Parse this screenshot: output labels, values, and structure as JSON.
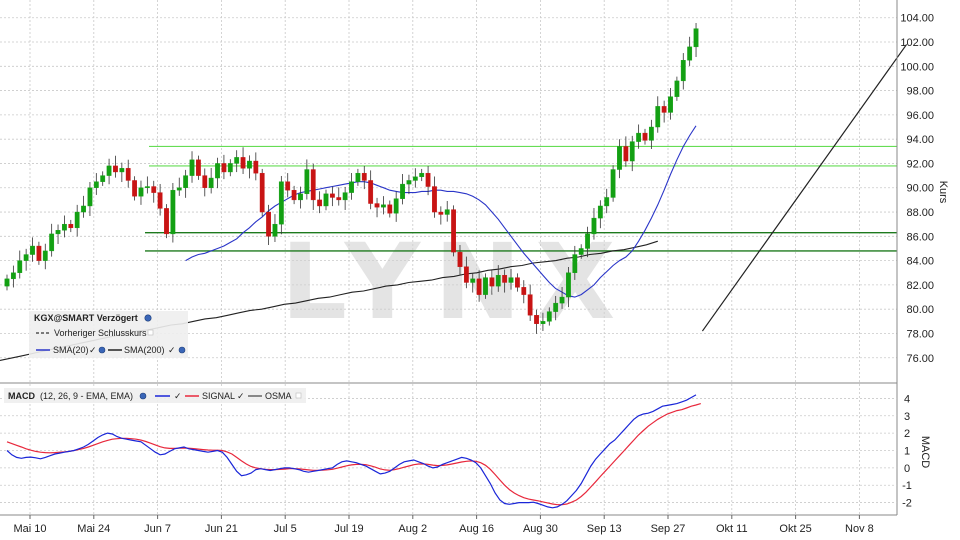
{
  "watermark": "LYNX",
  "colors": {
    "up": "#13a013",
    "down": "#c81414",
    "sma20": "#2a35c8",
    "sma200": "#222222",
    "macd": "#1a26d8",
    "signal": "#e8283c",
    "grid": "#c9c9c9",
    "support_dark": "#1e7a1e",
    "support_light": "#66dd55",
    "trendline": "#222222"
  },
  "legend": {
    "instrument": "KGX@SMART Verzögert",
    "prev_close": "Vorheriger Schlusskurs",
    "sma20": "SMA(20)",
    "sma200": "SMA(200)"
  },
  "macd_legend": {
    "label": "MACD",
    "params": "(12, 26, 9 - EMA, EMA)",
    "signal": "SIGNAL",
    "osma": "OSMA"
  },
  "chart_data": [
    {
      "type": "candlestick",
      "ylabel": "Kurs",
      "ylim": [
        74.5,
        104.8
      ],
      "yticks": [
        76,
        78,
        80,
        82,
        84,
        86,
        88,
        90,
        92,
        94,
        96,
        98,
        100,
        102,
        104
      ],
      "ytick_labels": [
        "76.00",
        "78.00",
        "80.00",
        "82.00",
        "84.00",
        "86.00",
        "88.00",
        "90.00",
        "92.00",
        "94.00",
        "96.00",
        "98.00",
        "100.00",
        "102.00",
        "104.00"
      ],
      "x_tick_labels": [
        "Mai 10",
        "Mai 24",
        "Jun 7",
        "Jun 21",
        "Jul 5",
        "Jul 19",
        "Aug 2",
        "Aug 16",
        "Aug 30",
        "Sep 13",
        "Sep 27",
        "Okt 11",
        "Okt 25",
        "Nov 8"
      ],
      "x_tick_index": [
        0,
        10,
        20,
        30,
        40,
        50,
        60,
        70,
        80,
        90,
        100,
        110,
        120,
        130
      ],
      "grid": true,
      "horizontal_lines": [
        {
          "y": 93.4,
          "style": "light"
        },
        {
          "y": 91.8,
          "style": "light"
        },
        {
          "y": 86.3,
          "style": "dark"
        },
        {
          "y": 84.8,
          "style": "dark"
        }
      ],
      "trendline": {
        "from": [
          109,
          78.2
        ],
        "to": [
          141,
          101.8
        ]
      },
      "close": [
        82.5,
        83.0,
        84.0,
        84.5,
        85.2,
        84.0,
        84.8,
        86.2,
        86.5,
        87.0,
        86.7,
        88.0,
        88.5,
        90.0,
        90.5,
        91.0,
        91.8,
        91.3,
        91.6,
        90.6,
        89.3,
        90.0,
        90.1,
        89.6,
        88.3,
        86.2,
        89.8,
        90.0,
        91.0,
        92.3,
        91.0,
        90.0,
        90.8,
        92.0,
        91.3,
        92.0,
        92.5,
        91.6,
        92.2,
        91.2,
        88.0,
        86.0,
        87.0,
        90.5,
        89.8,
        89.0,
        89.5,
        91.5,
        89.0,
        88.5,
        89.5,
        89.2,
        89.0,
        89.6,
        90.5,
        91.2,
        90.6,
        88.7,
        88.4,
        88.6,
        87.9,
        89.1,
        90.3,
        90.6,
        90.9,
        91.2,
        90.1,
        88.0,
        87.8,
        88.2,
        84.7,
        83.5,
        82.2,
        82.5,
        81.2,
        82.6,
        81.9,
        82.8,
        82.2,
        82.6,
        81.8,
        81.2,
        79.5,
        78.8,
        79.0,
        79.8,
        80.5,
        81.0,
        83.0,
        84.5,
        85.0,
        86.2,
        87.5,
        88.5,
        89.2,
        91.5,
        93.4,
        92.2,
        93.8,
        94.5,
        93.9,
        95.0,
        96.7,
        96.2,
        97.5,
        98.8,
        100.5,
        101.6,
        103.1
      ],
      "series": [
        {
          "name": "SMA(20)",
          "values": [
            84.0,
            84.3,
            84.5,
            84.6,
            84.8,
            85.0,
            85.2,
            85.5,
            85.8,
            86.3,
            86.7,
            87.2,
            87.6,
            88.1,
            88.5,
            88.8,
            89.1,
            89.4,
            89.6,
            89.7,
            89.8,
            89.9,
            90.0,
            90.1,
            90.2,
            90.3,
            90.4,
            90.5,
            90.5,
            90.4,
            90.2,
            90.0,
            89.8,
            89.7,
            89.6,
            89.6,
            89.6,
            89.7,
            89.7,
            89.8,
            89.8,
            89.7,
            89.7,
            89.6,
            89.5,
            89.3,
            89.0,
            88.6,
            88.0,
            87.4,
            86.7,
            86.0,
            85.3,
            84.6,
            84.0,
            83.4,
            82.8,
            82.2,
            81.7,
            81.4,
            81.1,
            81.0,
            81.2,
            81.6,
            82.0,
            82.6,
            83.1,
            83.6,
            84.0,
            84.3,
            84.8,
            85.6,
            86.5,
            87.5,
            88.6,
            89.8,
            91.1,
            92.3,
            93.4,
            94.3,
            95.1
          ]
        },
        {
          "name": "SMA(200)",
          "values": [
            75.0,
            75.2,
            75.4,
            75.6,
            75.8,
            76.0,
            76.2,
            76.4,
            76.6,
            76.8,
            77.0,
            77.2,
            77.4,
            77.6,
            77.8,
            78.0,
            78.2,
            78.3,
            78.5,
            78.7,
            78.8,
            79.0,
            79.2,
            79.3,
            79.5,
            79.7,
            79.9,
            80.0,
            80.2,
            80.4,
            80.5,
            80.7,
            80.9,
            81.0,
            81.2,
            81.4,
            81.5,
            81.7,
            81.9,
            82.0,
            82.2,
            82.3,
            82.4,
            82.6,
            82.7,
            82.9,
            83.0,
            83.2,
            83.3,
            83.5,
            83.6,
            83.8,
            83.9,
            84.0,
            84.2,
            84.3,
            84.5,
            84.6,
            84.8,
            84.9,
            85.1,
            85.3,
            85.6
          ]
        }
      ]
    },
    {
      "type": "line",
      "ylabel": "MACD",
      "ylim": [
        -2.6,
        4.6
      ],
      "yticks": [
        -2,
        -1,
        0,
        1,
        2,
        3,
        4
      ],
      "grid": true,
      "series": [
        {
          "name": "MACD",
          "values": [
            1.0,
            0.75,
            0.6,
            0.55,
            0.6,
            0.62,
            0.58,
            0.52,
            0.6,
            0.7,
            0.8,
            0.85,
            0.9,
            0.95,
            1.0,
            1.1,
            1.2,
            1.35,
            1.55,
            1.75,
            1.9,
            2.0,
            1.95,
            1.8,
            1.7,
            1.65,
            1.6,
            1.55,
            1.5,
            1.3,
            1.1,
            0.9,
            0.75,
            0.8,
            0.95,
            1.1,
            1.15,
            1.2,
            1.1,
            1.05,
            1.0,
            0.95,
            0.9,
            0.95,
            1.0,
            0.9,
            0.6,
            0.2,
            -0.2,
            -0.45,
            -0.4,
            -0.3,
            -0.1,
            -0.05,
            -0.1,
            -0.15,
            -0.1,
            -0.05,
            0.0,
            0.0,
            -0.05,
            -0.1,
            -0.2,
            -0.25,
            -0.2,
            -0.15,
            -0.1,
            -0.05,
            0.0,
            0.2,
            0.35,
            0.4,
            0.35,
            0.3,
            0.2,
            0.1,
            -0.05,
            -0.2,
            -0.35,
            -0.3,
            -0.2,
            0.0,
            0.2,
            0.35,
            0.4,
            0.45,
            0.35,
            0.25,
            0.1,
            0.0,
            0.05,
            0.2,
            0.3,
            0.4,
            0.5,
            0.6,
            0.55,
            0.45,
            0.3,
            0.0,
            -0.45,
            -0.9,
            -1.45,
            -1.85,
            -2.05,
            -2.1,
            -2.05,
            -2.0,
            -2.0,
            -2.0,
            -1.98,
            -2.05,
            -2.15,
            -2.25,
            -2.3,
            -2.25,
            -2.1,
            -1.9,
            -1.6,
            -1.3,
            -0.9,
            -0.4,
            0.1,
            0.5,
            0.8,
            1.1,
            1.4,
            1.6,
            1.9,
            2.2,
            2.5,
            2.8,
            3.0,
            3.1,
            3.15,
            3.25,
            3.4,
            3.55,
            3.6,
            3.65,
            3.7,
            3.8,
            3.9,
            4.05,
            4.2
          ]
        },
        {
          "name": "SIGNAL",
          "values": [
            1.5,
            1.4,
            1.3,
            1.2,
            1.1,
            1.02,
            0.95,
            0.9,
            0.88,
            0.87,
            0.88,
            0.9,
            0.92,
            0.95,
            1.0,
            1.05,
            1.12,
            1.2,
            1.3,
            1.4,
            1.5,
            1.58,
            1.65,
            1.68,
            1.7,
            1.7,
            1.68,
            1.65,
            1.6,
            1.52,
            1.42,
            1.32,
            1.22,
            1.15,
            1.12,
            1.12,
            1.13,
            1.14,
            1.13,
            1.11,
            1.08,
            1.05,
            1.03,
            1.02,
            1.02,
            1.0,
            0.92,
            0.8,
            0.6,
            0.4,
            0.22,
            0.08,
            0.0,
            -0.05,
            -0.08,
            -0.1,
            -0.1,
            -0.09,
            -0.07,
            -0.05,
            -0.05,
            -0.06,
            -0.09,
            -0.12,
            -0.14,
            -0.14,
            -0.13,
            -0.11,
            -0.08,
            -0.02,
            0.05,
            0.12,
            0.17,
            0.2,
            0.2,
            0.18,
            0.12,
            0.04,
            -0.06,
            -0.12,
            -0.14,
            -0.1,
            -0.04,
            0.04,
            0.11,
            0.18,
            0.22,
            0.23,
            0.2,
            0.16,
            0.13,
            0.14,
            0.17,
            0.22,
            0.28,
            0.34,
            0.38,
            0.4,
            0.38,
            0.3,
            0.15,
            -0.08,
            -0.38,
            -0.7,
            -1.0,
            -1.25,
            -1.45,
            -1.6,
            -1.72,
            -1.8,
            -1.85,
            -1.9,
            -1.96,
            -2.02,
            -2.08,
            -2.12,
            -2.12,
            -2.08,
            -1.98,
            -1.85,
            -1.65,
            -1.4,
            -1.1,
            -0.8,
            -0.5,
            -0.2,
            0.1,
            0.4,
            0.7,
            1.0,
            1.3,
            1.6,
            1.9,
            2.15,
            2.4,
            2.6,
            2.8,
            2.95,
            3.1,
            3.2,
            3.3,
            3.35,
            3.45,
            3.55,
            3.62,
            3.7
          ]
        }
      ]
    }
  ]
}
